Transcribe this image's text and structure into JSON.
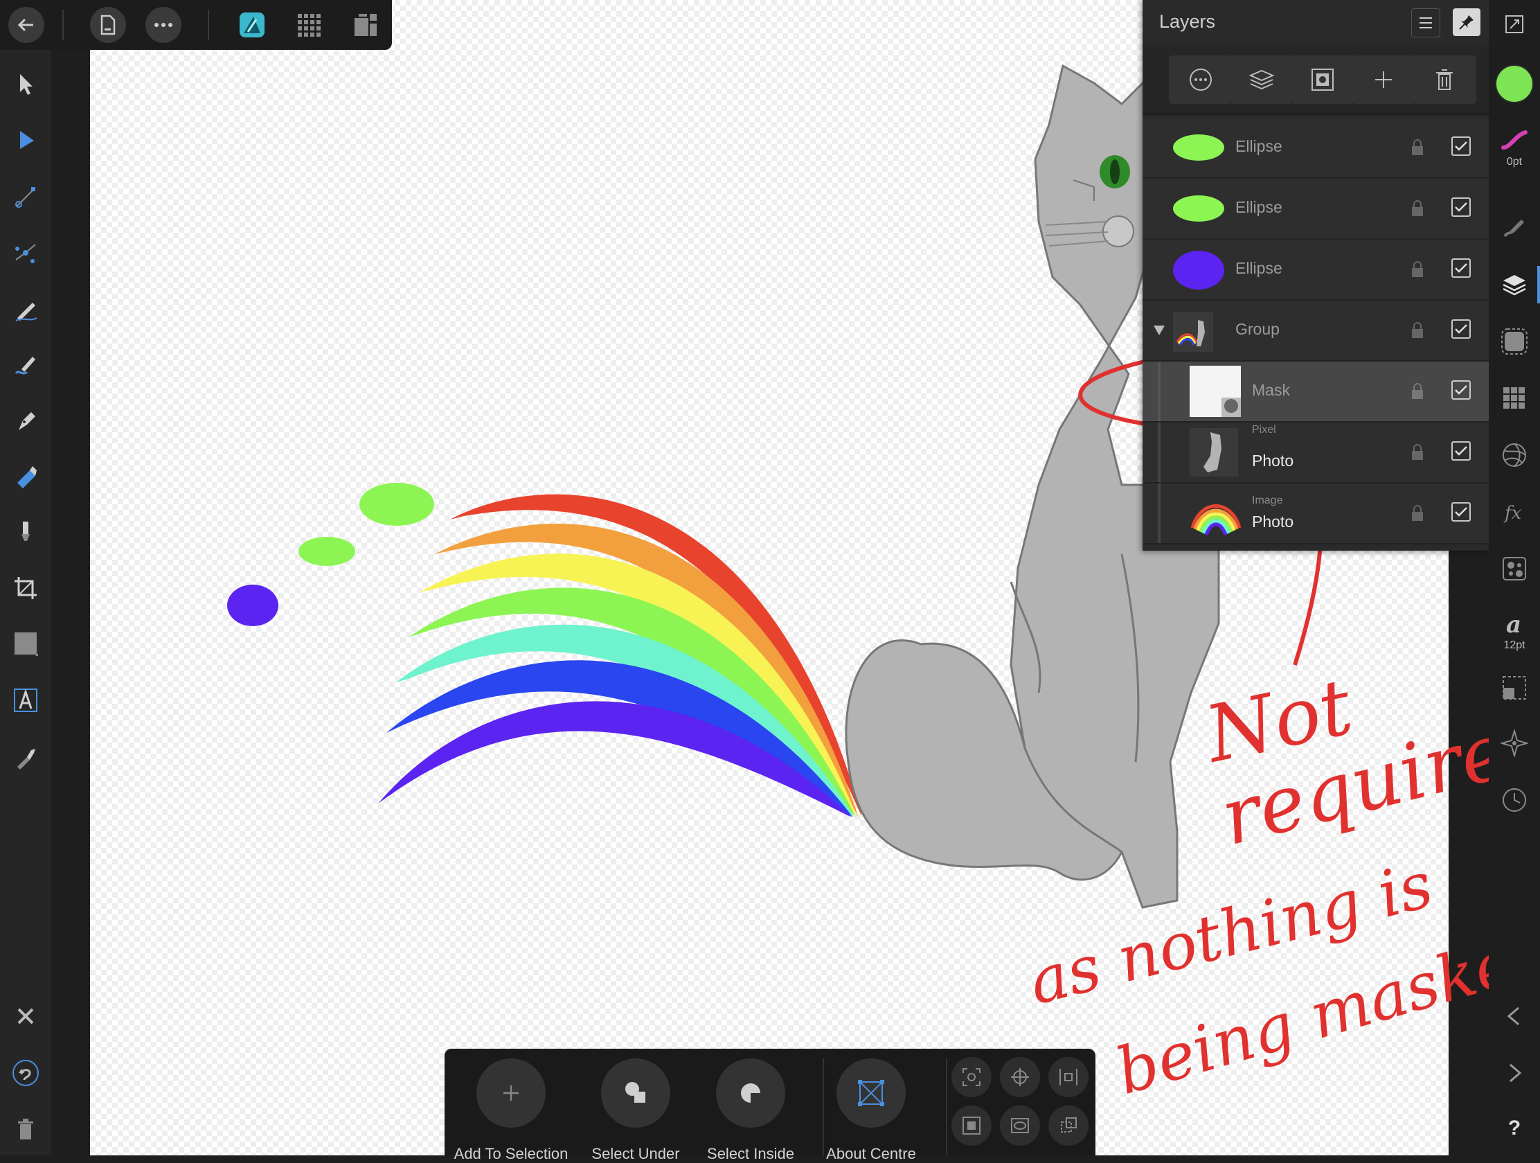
{
  "top_bar": {
    "icons": [
      "back-icon",
      "document-icon",
      "more-icon",
      "designer-persona-icon",
      "pixel-persona-icon",
      "export-persona-icon"
    ]
  },
  "left_toolbar": {
    "tools": [
      "move-tool",
      "node-tool",
      "point-transform-tool",
      "corner-tool",
      "pencil-tool",
      "vector-brush-tool",
      "pen-tool",
      "fill-tool",
      "transparency-tool",
      "crop-tool",
      "rectangle-tool",
      "text-tool",
      "color-picker-tool"
    ],
    "bottom": [
      "close-icon",
      "undo-icon",
      "trash-icon"
    ]
  },
  "layers_panel": {
    "title": "Layers",
    "layers": [
      {
        "name": "Ellipse",
        "thumb_color": "#8cf553",
        "locked": false,
        "visible": true
      },
      {
        "name": "Ellipse",
        "thumb_color": "#8cf553",
        "locked": false,
        "visible": true
      },
      {
        "name": "Ellipse",
        "thumb_color": "#5b24f0",
        "locked": false,
        "visible": true
      },
      {
        "name": "Group",
        "expanded": true,
        "visible": true
      },
      {
        "name": "Mask",
        "selected": true,
        "visible": true
      },
      {
        "kind": "Pixel",
        "name": "Photo",
        "visible": true
      },
      {
        "kind": "Image",
        "name": "Photo",
        "visible": true
      }
    ]
  },
  "right_bar": {
    "fill_color": "#7de553",
    "stroke_width_label": "0pt",
    "font_size_label": "12pt",
    "tools": [
      "color-studio",
      "stroke-studio",
      "brushes-studio",
      "layers-studio",
      "effects-studio",
      "swatches-studio",
      "adjustments-studio",
      "fx-studio",
      "styles-studio",
      "text-styles-studio",
      "transform-studio",
      "navigator-studio",
      "history-studio"
    ],
    "nav": [
      "chevron-left-icon",
      "chevron-right-icon",
      "help-icon"
    ],
    "help_label": "?"
  },
  "context_bar": {
    "buttons": [
      {
        "label": "Add To Selection"
      },
      {
        "label": "Select Under"
      },
      {
        "label": "Select Inside"
      },
      {
        "label": "About Centre"
      }
    ]
  },
  "annotation": {
    "lines": [
      "Not",
      "required",
      "as nothing is",
      "being masked"
    ],
    "color": "#e0312f"
  },
  "canvas": {
    "rainbow_colors": [
      "#e8432d",
      "#f2a03e",
      "#f8f354",
      "#8cf553",
      "#6ff3ce",
      "#2946f0",
      "#5b24f0"
    ],
    "ellipse_colors": [
      "#8cf553",
      "#8cf553",
      "#5b24f0"
    ]
  }
}
